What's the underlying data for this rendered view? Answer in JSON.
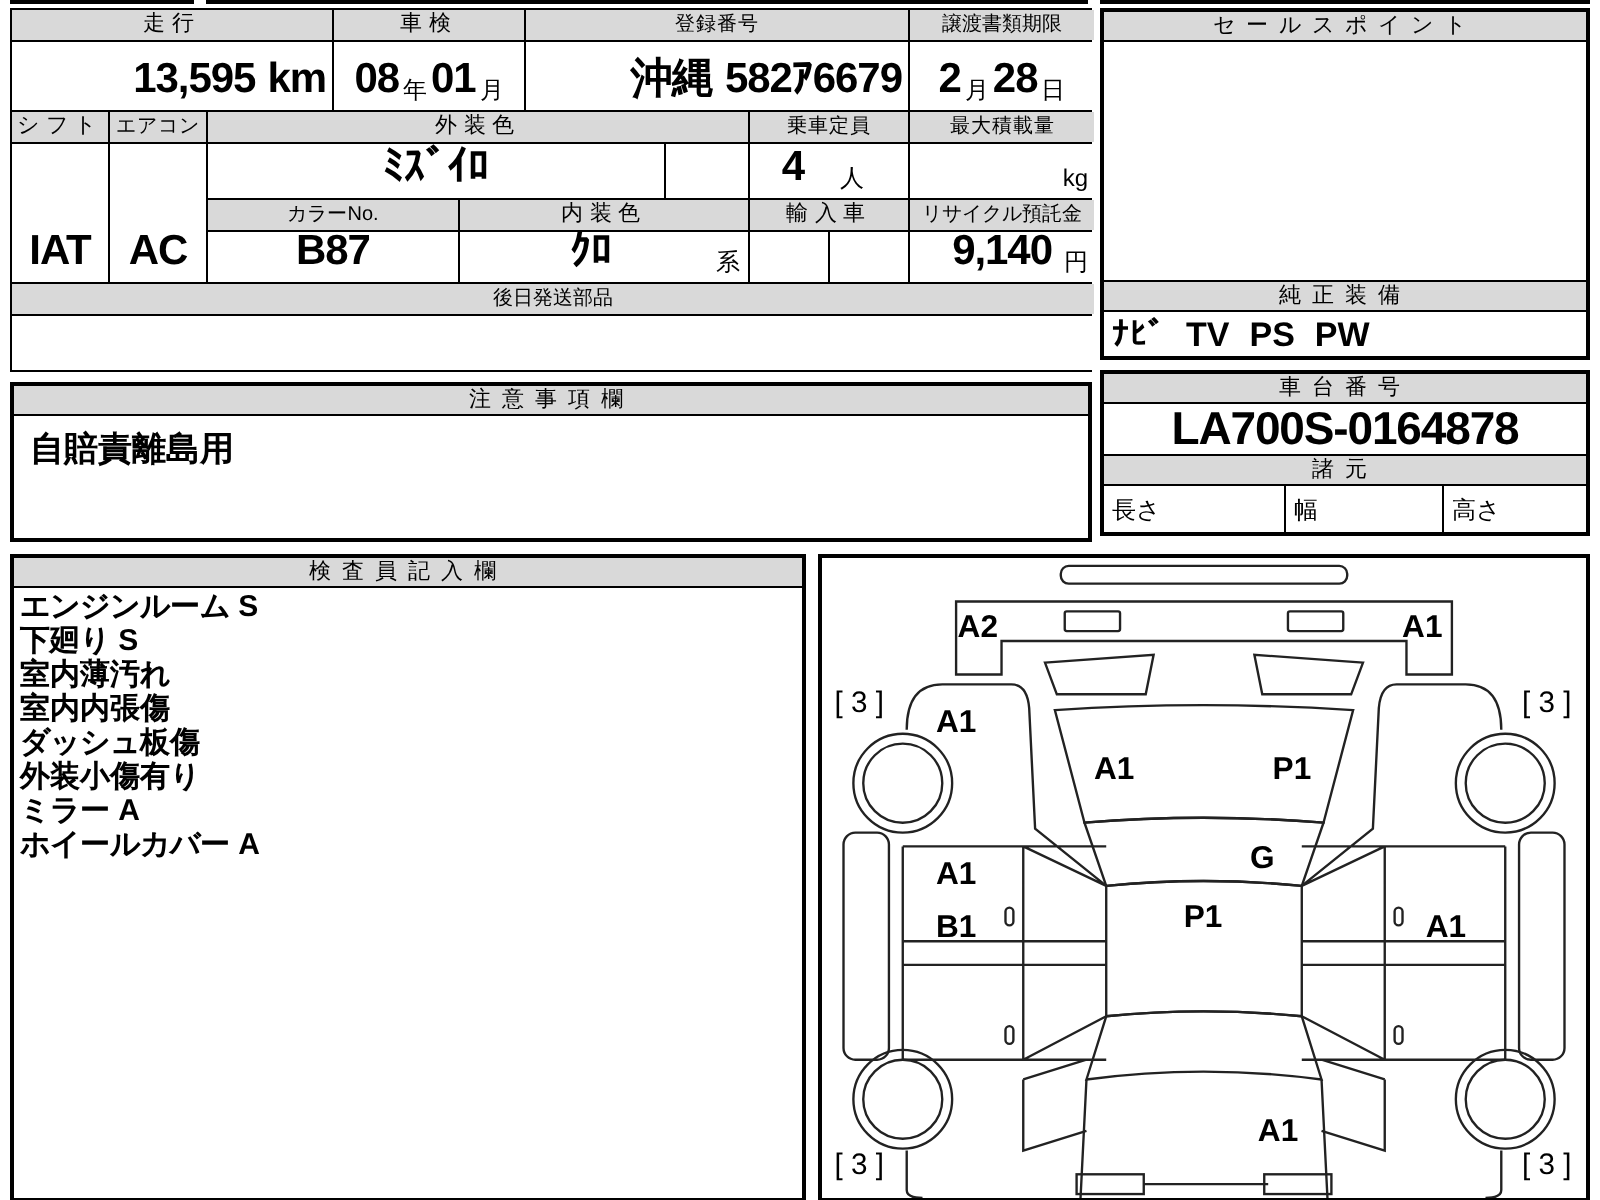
{
  "vehicle_table": {
    "cells": [
      {
        "kind": "header",
        "text": "走行"
      },
      {
        "kind": "header",
        "text": "車検"
      },
      {
        "kind": "header",
        "text": "登録番号"
      },
      {
        "kind": "header",
        "text": "譲渡書類期限"
      },
      {
        "kind": "value",
        "parts": [
          {
            "text": "13,595",
            "kind": "big"
          },
          {
            "text": "km",
            "kind": "big"
          }
        ]
      },
      {
        "kind": "value",
        "parts": [
          {
            "text": "08",
            "kind": "big"
          },
          {
            "text": "年",
            "kind": "unit"
          },
          {
            "text": "01",
            "kind": "big"
          },
          {
            "text": "月",
            "kind": "unit"
          }
        ]
      },
      {
        "kind": "value",
        "parts": [
          {
            "text": "沖縄",
            "kind": "big"
          },
          {
            "text": "582ｱ6679",
            "kind": "big"
          }
        ]
      },
      {
        "kind": "value",
        "parts": [
          {
            "text": "2",
            "kind": "big"
          },
          {
            "text": "月",
            "kind": "unit"
          },
          {
            "text": "28",
            "kind": "big"
          },
          {
            "text": "日",
            "kind": "unit"
          }
        ]
      },
      {
        "kind": "header",
        "text": "シフト"
      },
      {
        "kind": "header",
        "text": "エアコン"
      },
      {
        "kind": "header",
        "text": "外装色"
      },
      {
        "kind": "header",
        "text": "乗車定員"
      },
      {
        "kind": "header",
        "text": "最大積載量"
      },
      {
        "kind": "value",
        "parts": [
          {
            "text": "IAT",
            "kind": "big"
          }
        ]
      },
      {
        "kind": "value",
        "parts": [
          {
            "text": "AC",
            "kind": "big"
          }
        ]
      },
      {
        "kind": "value",
        "parts": [
          {
            "text": "ﾐｽﾞｲﾛ",
            "kind": "big"
          }
        ]
      },
      {
        "kind": "empty"
      },
      {
        "kind": "value",
        "parts": [
          {
            "text": "4",
            "kind": "big"
          },
          {
            "text": "人",
            "kind": "unit"
          }
        ]
      },
      {
        "kind": "value",
        "parts": [
          {
            "text": "kg",
            "kind": "unit"
          }
        ]
      },
      {
        "kind": "header",
        "text": "カラーNo."
      },
      {
        "kind": "header",
        "text": "内装色"
      },
      {
        "kind": "header",
        "text": "輸入車"
      },
      {
        "kind": "header",
        "text": "リサイクル預託金"
      },
      {
        "kind": "value",
        "parts": [
          {
            "text": "B87",
            "kind": "big"
          }
        ]
      },
      {
        "kind": "value",
        "parts": [
          {
            "text": "ｸﾛ",
            "kind": "big"
          },
          {
            "text": "系",
            "kind": "unit"
          }
        ]
      },
      {
        "kind": "empty"
      },
      {
        "kind": "empty"
      },
      {
        "kind": "value",
        "parts": [
          {
            "text": "9,140",
            "kind": "big"
          },
          {
            "text": "円",
            "kind": "unit"
          }
        ]
      },
      {
        "kind": "header",
        "text": "後日発送部品"
      },
      {
        "kind": "empty"
      }
    ]
  },
  "sales_point": {
    "title": "セールスポイント"
  },
  "standard_equipment": {
    "title": "純正装備",
    "items": [
      "ﾅﾋﾞ",
      "TV",
      "PS",
      "PW"
    ]
  },
  "notes": {
    "title": "注意事項欄",
    "text": "自賠責離島用"
  },
  "chassis": {
    "title": "車台番号",
    "number": "LA700S-0164878",
    "spec_title": "諸元",
    "spec_labels": [
      "長さ",
      "幅",
      "高さ"
    ]
  },
  "inspector": {
    "title": "検査員記入欄",
    "lines": [
      "エンジンルーム S",
      "下廻り S",
      "室内薄汚れ",
      "室内内張傷",
      "ダッシュ板傷",
      "外装小傷有り",
      "ミラー A",
      "ホイールカバー A"
    ]
  },
  "diagram": {
    "marks": [
      {
        "codes": [
          "A2"
        ]
      },
      {
        "codes": [
          "A1"
        ]
      },
      {
        "codes": [
          "A1"
        ]
      },
      {
        "codes": [
          "A1"
        ]
      },
      {
        "codes": [
          "P1"
        ]
      },
      {
        "codes": [
          "G"
        ]
      },
      {
        "codes": [
          "A1",
          "B1"
        ]
      },
      {
        "codes": [
          "P1"
        ]
      },
      {
        "codes": [
          "A1"
        ]
      },
      {
        "codes": [
          "A1"
        ]
      }
    ],
    "tires": [
      "[ 3 ]",
      "[ 3 ]",
      "[ 3 ]",
      "[ 3 ]"
    ]
  }
}
